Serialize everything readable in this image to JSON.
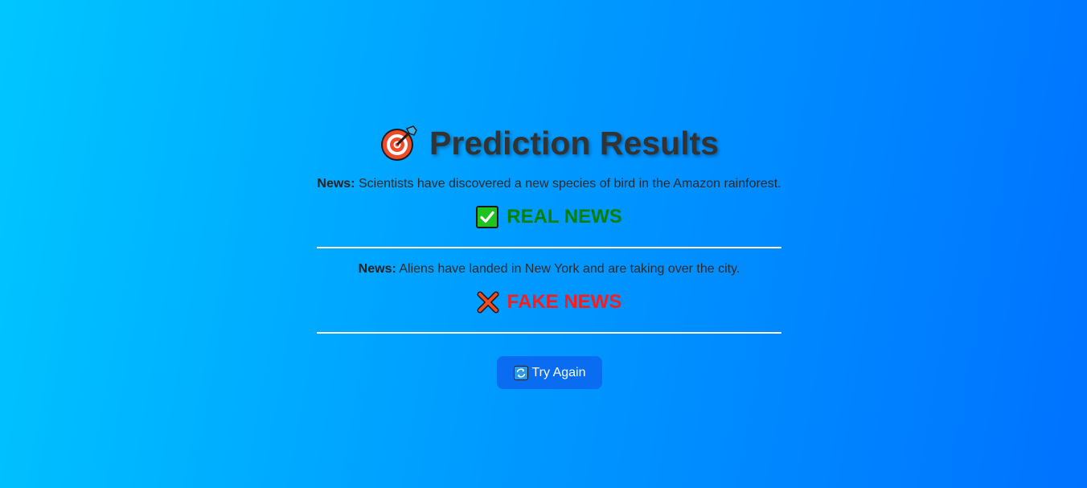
{
  "header": {
    "title": "Prediction Results",
    "icon": "target-icon"
  },
  "results": [
    {
      "news_label": "News:",
      "news_text": " Scientists have discovered a new species of bird in the Amazon rainforest.",
      "verdict": "REAL NEWS",
      "verdict_icon": "check-mark-icon",
      "verdict_color": "#008000"
    },
    {
      "news_label": "News:",
      "news_text": " Aliens have landed in New York and are taking over the city.",
      "verdict": "FAKE NEWS",
      "verdict_icon": "cross-mark-icon",
      "verdict_color": "#ff1a1a"
    }
  ],
  "actions": {
    "try_again_label": "Try Again",
    "try_again_icon": "refresh-icon",
    "button_color": "#0a6cf0"
  },
  "colors": {
    "gradient_start": "#00c6ff",
    "gradient_end": "#0072ff"
  }
}
